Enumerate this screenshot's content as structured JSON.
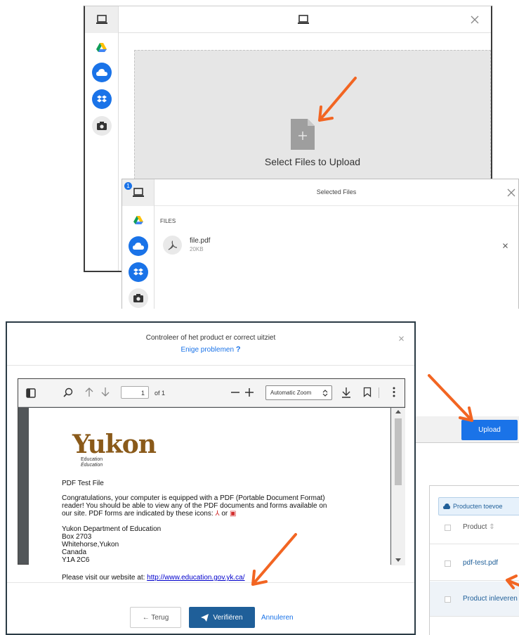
{
  "dialog1": {
    "drop_label": "Select Files to Upload",
    "sources": [
      "computer-icon",
      "google-drive-icon",
      "onedrive-icon",
      "dropbox-icon",
      "camera-icon"
    ]
  },
  "dialog2": {
    "badge": "1",
    "title": "Selected Files",
    "section_label": "FILES",
    "file": {
      "name": "file.pdf",
      "size": "20KB"
    }
  },
  "upload_button": "Upload",
  "verify_dialog": {
    "title": "Controleer of het product er correct uitziet",
    "help_link": "Enige problemen",
    "help_mark": "?",
    "viewer": {
      "page_number": "1",
      "page_total": "of 1",
      "zoom": "Automatic Zoom"
    },
    "pdf": {
      "logo": "Yukon",
      "logo_sub1": "Education",
      "logo_sub2": "Éducation",
      "heading": "PDF Test File",
      "paragraph_line1": "Congratulations, your computer is equipped with a PDF (Portable Document Format)",
      "paragraph_line2": "reader!  You should be able to view any of the PDF documents and forms available on",
      "paragraph_line3": "our site.  PDF forms are indicated by these icons:",
      "paragraph_or": "or",
      "address1": "Yukon Department of Education",
      "address2": "Box 2703",
      "address3": "Whitehorse,Yukon",
      "address4": "Canada",
      "address5": "Y1A 2C6",
      "visit_text": "Please visit our website at:",
      "visit_link": "http://www.education.gov.yk.ca/"
    },
    "back_button": "← Terug",
    "verify_button": "Verifiëren",
    "cancel_link": "Annuleren"
  },
  "product_panel": {
    "add_button": "Producten toevoe",
    "column_header": "Product",
    "rows": [
      "pdf-test.pdf",
      "Product inleveren"
    ]
  },
  "colors": {
    "accent_blue": "#1a73e8",
    "dark_blue": "#1f5f99",
    "arrow_orange": "#f26522",
    "logo_brown": "#8a5a1a"
  }
}
